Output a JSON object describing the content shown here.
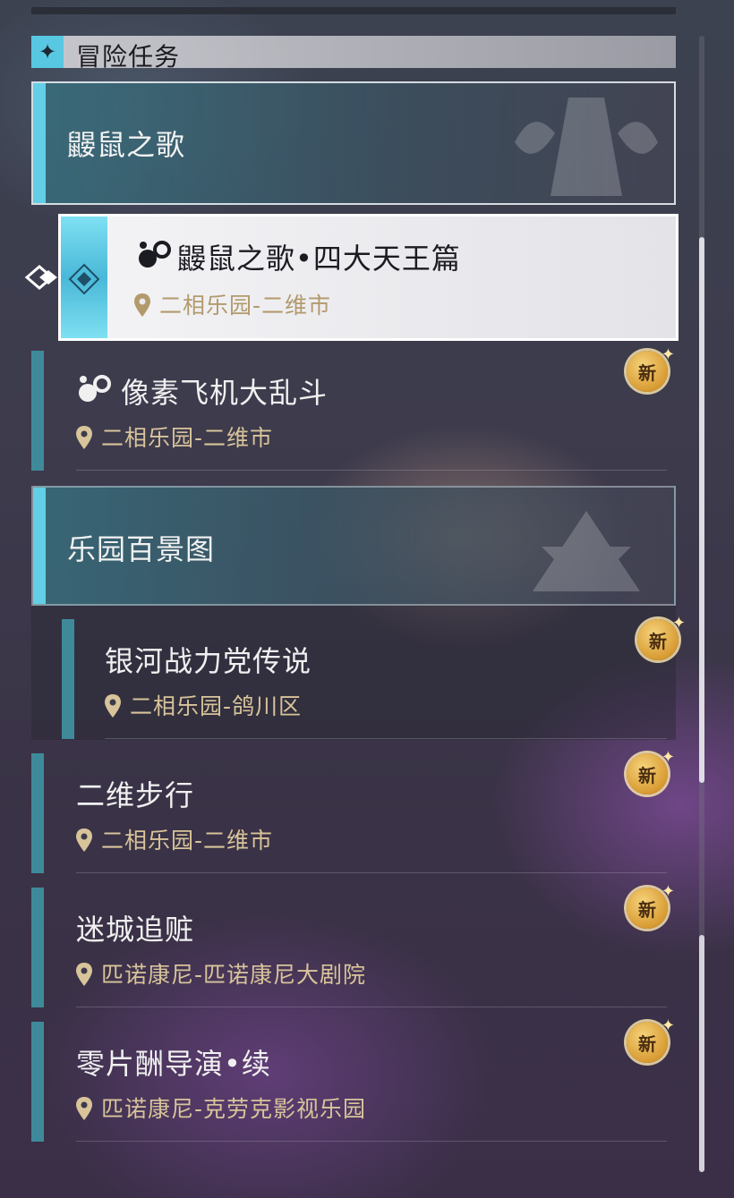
{
  "header": {
    "title": "冒险任务"
  },
  "groups": [
    {
      "title": "鼹鼠之歌"
    },
    {
      "title": "乐园百景图"
    }
  ],
  "selected_quest": {
    "title": "鼹鼠之歌•四大天王篇",
    "location": "二相乐园-二维市"
  },
  "quests": [
    {
      "title": "像素飞机大乱斗",
      "location": "二相乐园-二维市",
      "badge": "新"
    },
    {
      "title": "银河战力党传说",
      "location": "二相乐园-鸽川区",
      "badge": "新"
    },
    {
      "title": "二维步行",
      "location": "二相乐园-二维市",
      "badge": "新"
    },
    {
      "title": "迷城追赃",
      "location": "匹诺康尼-匹诺康尼大剧院",
      "badge": "新"
    },
    {
      "title": "零片酬导演•续",
      "location": "匹诺康尼-克劳克影视乐园",
      "badge": "新"
    }
  ],
  "colors": {
    "accent_cyan": "#62cfe6",
    "quest_bar": "#3f8a9a",
    "location_gold": "#d8c49a",
    "badge_gold": "#d89b32"
  }
}
